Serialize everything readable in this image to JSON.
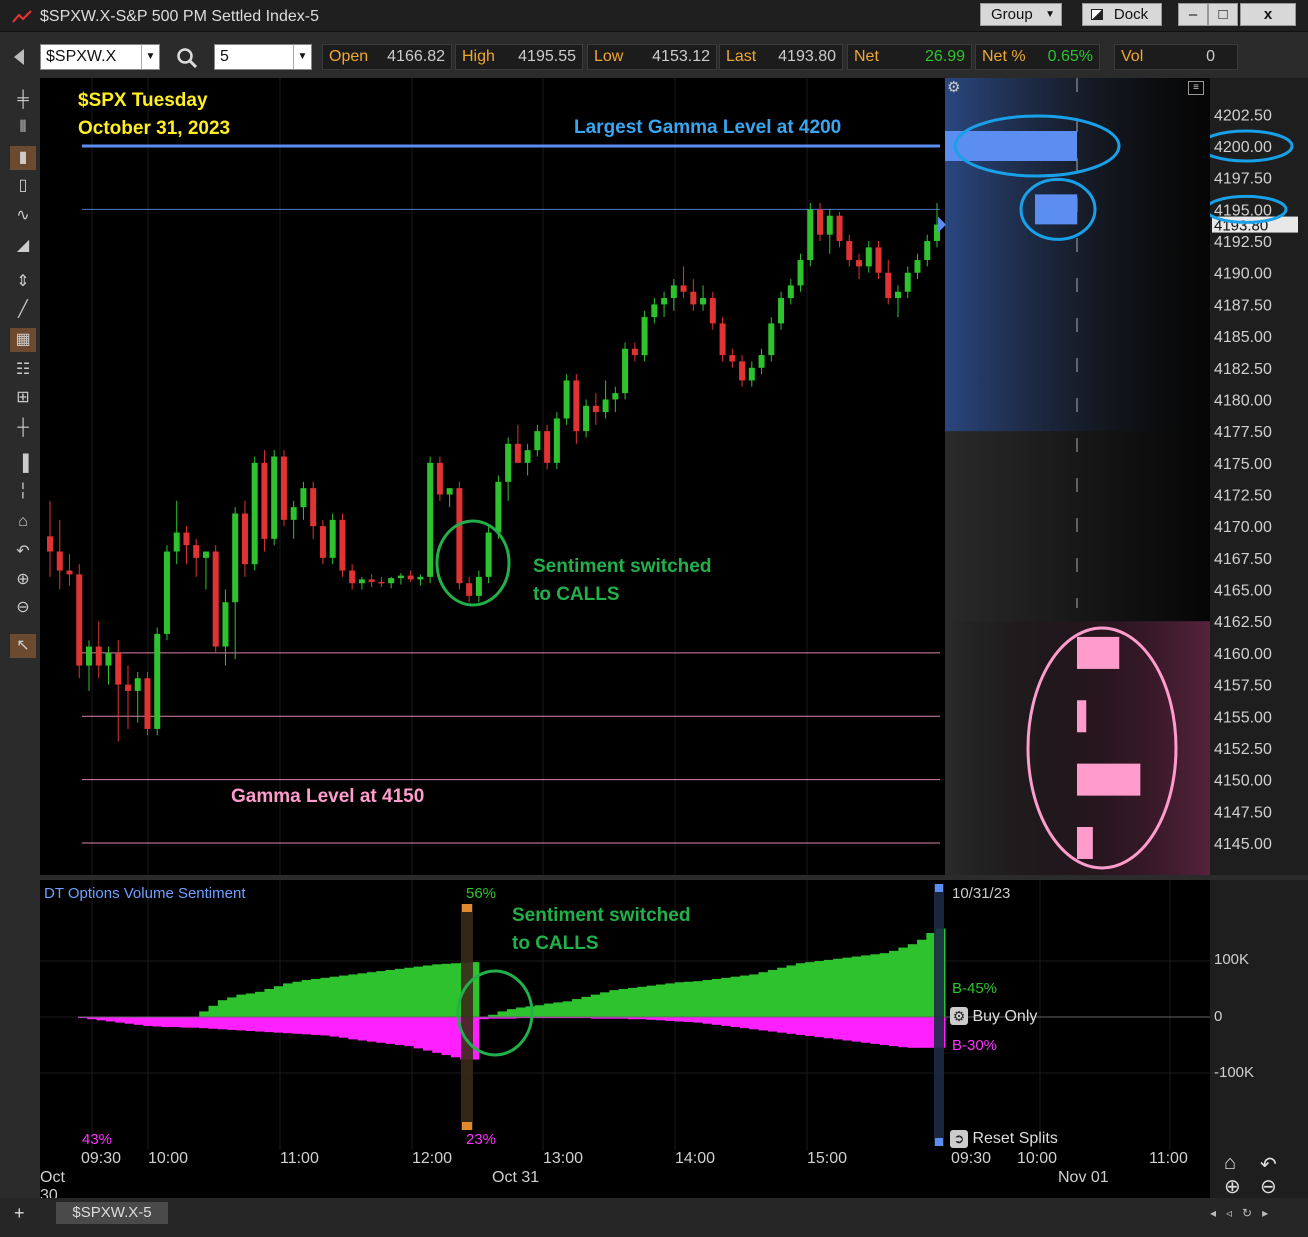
{
  "window": {
    "title": "$SPXW.X-S&P 500 PM Settled Index-5",
    "group_label": "Group",
    "dock_label": "Dock",
    "minimize": "–",
    "maximize": "□",
    "close": "x"
  },
  "quote": {
    "symbol": "$SPXW.X",
    "interval": "5",
    "open_label": "Open",
    "open": "4166.82",
    "high_label": "High",
    "high": "4195.55",
    "low_label": "Low",
    "low": "4153.12",
    "last_label": "Last",
    "last": "4193.80",
    "net_label": "Net",
    "net": "26.99",
    "netpct_label": "Net %",
    "netpct": "0.65%",
    "vol_label": "Vol",
    "vol": "0"
  },
  "annotations": {
    "title_line1": "$SPX Tuesday",
    "title_line2": "October 31, 2023",
    "largest_gamma": "Largest Gamma Level at 4200",
    "sentiment_1": "Sentiment switched",
    "sentiment_2": "to CALLS",
    "gamma_4150": "Gamma Level at 4150",
    "vol_sentiment_1": "Sentiment switched",
    "vol_sentiment_2": "to CALLS"
  },
  "price_axis": {
    "labels": [
      "4202.50",
      "4200.00",
      "4197.50",
      "4195.00",
      "4192.50",
      "4190.00",
      "4187.50",
      "4185.00",
      "4182.50",
      "4180.00",
      "4177.50",
      "4175.00",
      "4172.50",
      "4170.00",
      "4167.50",
      "4165.00",
      "4162.50",
      "4160.00",
      "4157.50",
      "4155.00",
      "4152.50",
      "4150.00",
      "4147.50",
      "4145.00"
    ],
    "last_tag": "4193.80"
  },
  "indicator": {
    "title": "DT Options Volume Sentiment",
    "pct_top": "56%",
    "pct_bottom_left": "43%",
    "pct_bottom_mid": "23%",
    "date_label": "10/31/23",
    "buy_pct": "B-45%",
    "sell_pct": "B-30%",
    "buy_only": "Buy Only",
    "reset_splits": "Reset Splits",
    "axis": [
      "100K",
      "0",
      "-100K"
    ]
  },
  "time_axis": {
    "times": [
      "09:30",
      "10:00",
      "11:00",
      "12:00",
      "13:00",
      "14:00",
      "15:00",
      "09:30",
      "10:00",
      "11:00"
    ],
    "dates": [
      "Oct 30",
      "Oct 31",
      "Nov 01"
    ]
  },
  "footer": {
    "tab": "$SPXW.X-5",
    "add": "+"
  },
  "colors": {
    "up": "#2ec32e",
    "down": "#e03434",
    "gamma_call": "#5b8ef0",
    "gamma_put": "#ff9ccc",
    "annotation_yellow": "#ffee22",
    "annotation_green": "#22b04a",
    "annotation_blue": "#38a6f0",
    "annotation_pink": "#ff9ccc"
  },
  "chart_data": {
    "type": "candlestick",
    "interval_minutes": 5,
    "y_range": [
      4143.5,
      4204.5
    ],
    "gamma_levels": [
      {
        "price": 4200,
        "size": 1.0,
        "side": "call"
      },
      {
        "price": 4195,
        "size": 0.32,
        "side": "call"
      },
      {
        "price": 4160,
        "size": 0.32,
        "side": "put"
      },
      {
        "price": 4155,
        "size": 0.07,
        "side": "put"
      },
      {
        "price": 4150,
        "size": 0.48,
        "side": "put"
      },
      {
        "price": 4145,
        "size": 0.12,
        "side": "put"
      }
    ],
    "horizontal_lines": [
      4200,
      4195,
      4160,
      4155,
      4150,
      4145
    ],
    "candles": [
      [
        4169.2,
        4172.0,
        4166.0,
        4168.0
      ],
      [
        4168.0,
        4170.5,
        4165.0,
        4166.5
      ],
      [
        4166.5,
        4167.8,
        4165.3,
        4166.2
      ],
      [
        4166.2,
        4167.0,
        4158.0,
        4159.0
      ],
      [
        4159.0,
        4161.0,
        4157.0,
        4160.5
      ],
      [
        4160.5,
        4162.5,
        4158.0,
        4159.0
      ],
      [
        4159.0,
        4160.5,
        4157.5,
        4160.0
      ],
      [
        4160.0,
        4161.0,
        4153.0,
        4157.5
      ],
      [
        4157.5,
        4159.0,
        4154.0,
        4157.0
      ],
      [
        4157.0,
        4158.5,
        4154.5,
        4158.0
      ],
      [
        4158.0,
        4158.5,
        4153.5,
        4154.0
      ],
      [
        4154.0,
        4162.0,
        4153.5,
        4161.5
      ],
      [
        4161.5,
        4168.5,
        4161.0,
        4168.0
      ],
      [
        4168.0,
        4172.0,
        4167.0,
        4169.5
      ],
      [
        4169.5,
        4170.0,
        4167.0,
        4168.5
      ],
      [
        4168.5,
        4169.0,
        4166.0,
        4167.5
      ],
      [
        4167.5,
        4168.0,
        4165.0,
        4168.0
      ],
      [
        4168.0,
        4168.5,
        4160.0,
        4160.5
      ],
      [
        4160.5,
        4165.0,
        4159.0,
        4164.0
      ],
      [
        4164.0,
        4171.5,
        4159.5,
        4171.0
      ],
      [
        4171.0,
        4172.0,
        4166.0,
        4167.0
      ],
      [
        4167.0,
        4175.5,
        4166.5,
        4175.0
      ],
      [
        4175.0,
        4176.0,
        4168.0,
        4169.0
      ],
      [
        4169.0,
        4176.0,
        4168.5,
        4175.5
      ],
      [
        4175.5,
        4176.0,
        4170.0,
        4170.5
      ],
      [
        4170.5,
        4172.0,
        4169.0,
        4171.5
      ],
      [
        4171.5,
        4173.5,
        4170.5,
        4173.0
      ],
      [
        4173.0,
        4173.5,
        4169.0,
        4170.0
      ],
      [
        4170.0,
        4170.5,
        4167.0,
        4167.5
      ],
      [
        4167.5,
        4171.0,
        4167.0,
        4170.5
      ],
      [
        4170.5,
        4171.0,
        4166.0,
        4166.5
      ],
      [
        4166.5,
        4167.0,
        4165.0,
        4165.5
      ],
      [
        4165.5,
        4166.0,
        4165.0,
        4165.8
      ],
      [
        4165.8,
        4166.2,
        4165.2,
        4165.6
      ],
      [
        4165.6,
        4166.0,
        4165.2,
        4165.5
      ],
      [
        4165.5,
        4166.0,
        4165.1,
        4165.9
      ],
      [
        4165.9,
        4166.3,
        4165.4,
        4166.1
      ],
      [
        4166.1,
        4166.5,
        4165.6,
        4165.8
      ],
      [
        4165.8,
        4166.2,
        4165.3,
        4166.0
      ],
      [
        4166.0,
        4175.5,
        4165.5,
        4175.0
      ],
      [
        4175.0,
        4175.5,
        4172.0,
        4172.5
      ],
      [
        4172.5,
        4173.0,
        4171.5,
        4173.0
      ],
      [
        4173.0,
        4173.5,
        4165.0,
        4165.5
      ],
      [
        4165.5,
        4166.0,
        4164.0,
        4164.5
      ],
      [
        4164.5,
        4166.5,
        4164.0,
        4166.0
      ],
      [
        4166.0,
        4170.0,
        4165.5,
        4169.5
      ],
      [
        4169.5,
        4174.0,
        4169.0,
        4173.5
      ],
      [
        4173.5,
        4177.0,
        4172.0,
        4176.5
      ],
      [
        4176.5,
        4178.0,
        4175.0,
        4175.0
      ],
      [
        4175.0,
        4176.5,
        4174.0,
        4176.0
      ],
      [
        4176.0,
        4178.0,
        4175.5,
        4177.5
      ],
      [
        4177.5,
        4178.0,
        4174.5,
        4175.0
      ],
      [
        4175.0,
        4179.0,
        4174.5,
        4178.5
      ],
      [
        4178.5,
        4182.0,
        4178.0,
        4181.5
      ],
      [
        4181.5,
        4182.0,
        4176.5,
        4177.5
      ],
      [
        4177.5,
        4180.0,
        4177.0,
        4179.5
      ],
      [
        4179.5,
        4180.5,
        4178.0,
        4179.0
      ],
      [
        4179.0,
        4181.5,
        4178.5,
        4180.0
      ],
      [
        4180.0,
        4181.0,
        4179.0,
        4180.5
      ],
      [
        4180.5,
        4184.5,
        4180.0,
        4184.0
      ],
      [
        4184.0,
        4184.5,
        4183.0,
        4183.5
      ],
      [
        4183.5,
        4187.0,
        4183.0,
        4186.5
      ],
      [
        4186.5,
        4188.0,
        4186.0,
        4187.5
      ],
      [
        4187.5,
        4188.5,
        4186.5,
        4188.0
      ],
      [
        4188.0,
        4189.5,
        4187.0,
        4189.0
      ],
      [
        4189.0,
        4190.5,
        4188.0,
        4188.5
      ],
      [
        4188.5,
        4189.5,
        4187.0,
        4187.5
      ],
      [
        4187.5,
        4189.0,
        4187.0,
        4188.0
      ],
      [
        4188.0,
        4188.5,
        4185.5,
        4186.0
      ],
      [
        4186.0,
        4186.5,
        4183.0,
        4183.5
      ],
      [
        4183.5,
        4184.0,
        4182.5,
        4183.0
      ],
      [
        4183.0,
        4183.5,
        4181.0,
        4181.5
      ],
      [
        4181.5,
        4183.0,
        4181.0,
        4182.5
      ],
      [
        4182.5,
        4184.0,
        4182.0,
        4183.5
      ],
      [
        4183.5,
        4186.5,
        4183.0,
        4186.0
      ],
      [
        4186.0,
        4188.5,
        4185.5,
        4188.0
      ],
      [
        4188.0,
        4189.5,
        4187.5,
        4189.0
      ],
      [
        4189.0,
        4191.5,
        4188.5,
        4191.0
      ],
      [
        4191.0,
        4195.5,
        4190.5,
        4195.0
      ],
      [
        4195.0,
        4195.5,
        4192.5,
        4193.0
      ],
      [
        4193.0,
        4195.0,
        4191.5,
        4194.5
      ],
      [
        4194.5,
        4194.8,
        4192.0,
        4192.5
      ],
      [
        4192.5,
        4193.0,
        4190.5,
        4191.0
      ],
      [
        4191.0,
        4191.5,
        4189.5,
        4190.5
      ],
      [
        4190.5,
        4192.5,
        4190.0,
        4192.0
      ],
      [
        4192.0,
        4192.5,
        4189.5,
        4190.0
      ],
      [
        4190.0,
        4191.0,
        4187.5,
        4188.0
      ],
      [
        4188.0,
        4189.0,
        4186.5,
        4188.5
      ],
      [
        4188.5,
        4190.5,
        4188.0,
        4190.0
      ],
      [
        4190.0,
        4191.5,
        4189.5,
        4191.0
      ],
      [
        4191.0,
        4193.0,
        4190.5,
        4192.5
      ],
      [
        4192.5,
        4195.5,
        4192.0,
        4193.8
      ]
    ],
    "sentiment": {
      "buy_volume_k": [
        0,
        0,
        0,
        0,
        0,
        0,
        0,
        0,
        0,
        0,
        0,
        0,
        0,
        10,
        20,
        30,
        35,
        40,
        42,
        45,
        50,
        55,
        60,
        63,
        66,
        68,
        70,
        72,
        74,
        76,
        78,
        80,
        82,
        84,
        86,
        88,
        90,
        92,
        94,
        95,
        96,
        97,
        98,
        0,
        4,
        10,
        14,
        17,
        19,
        21,
        24,
        26,
        28,
        32,
        36,
        40,
        44,
        48,
        50,
        52,
        54,
        56,
        58,
        60,
        62,
        63,
        64,
        66,
        68,
        70,
        72,
        74,
        76,
        80,
        84,
        88,
        92,
        96,
        98,
        100,
        102,
        104,
        106,
        108,
        110,
        112,
        114,
        118,
        124,
        130,
        138,
        150,
        158
      ],
      "sell_volume_k": [
        -2,
        -4,
        -6,
        -8,
        -10,
        -12,
        -14,
        -16,
        -17,
        -18,
        -18,
        -19,
        -19,
        -20,
        -21,
        -22,
        -23,
        -24,
        -25,
        -26,
        -27,
        -28,
        -29,
        -30,
        -31,
        -32,
        -33,
        -35,
        -37,
        -40,
        -42,
        -44,
        -46,
        -48,
        -50,
        -52,
        -56,
        -60,
        -64,
        -68,
        -72,
        -76,
        -76,
        -4,
        -3,
        -3,
        -3,
        -2,
        -2,
        -2,
        -2,
        -2,
        -2,
        -2,
        -2,
        -3,
        -3,
        -3,
        -3,
        -4,
        -4,
        -5,
        -6,
        -7,
        -8,
        -9,
        -10,
        -12,
        -14,
        -16,
        -18,
        -20,
        -22,
        -24,
        -26,
        -28,
        -30,
        -32,
        -34,
        -36,
        -38,
        -40,
        -42,
        -44,
        -46,
        -48,
        -50,
        -52,
        -54,
        -55,
        -55,
        -55,
        -55
      ],
      "axis_range_k": [
        -120,
        120
      ]
    }
  }
}
